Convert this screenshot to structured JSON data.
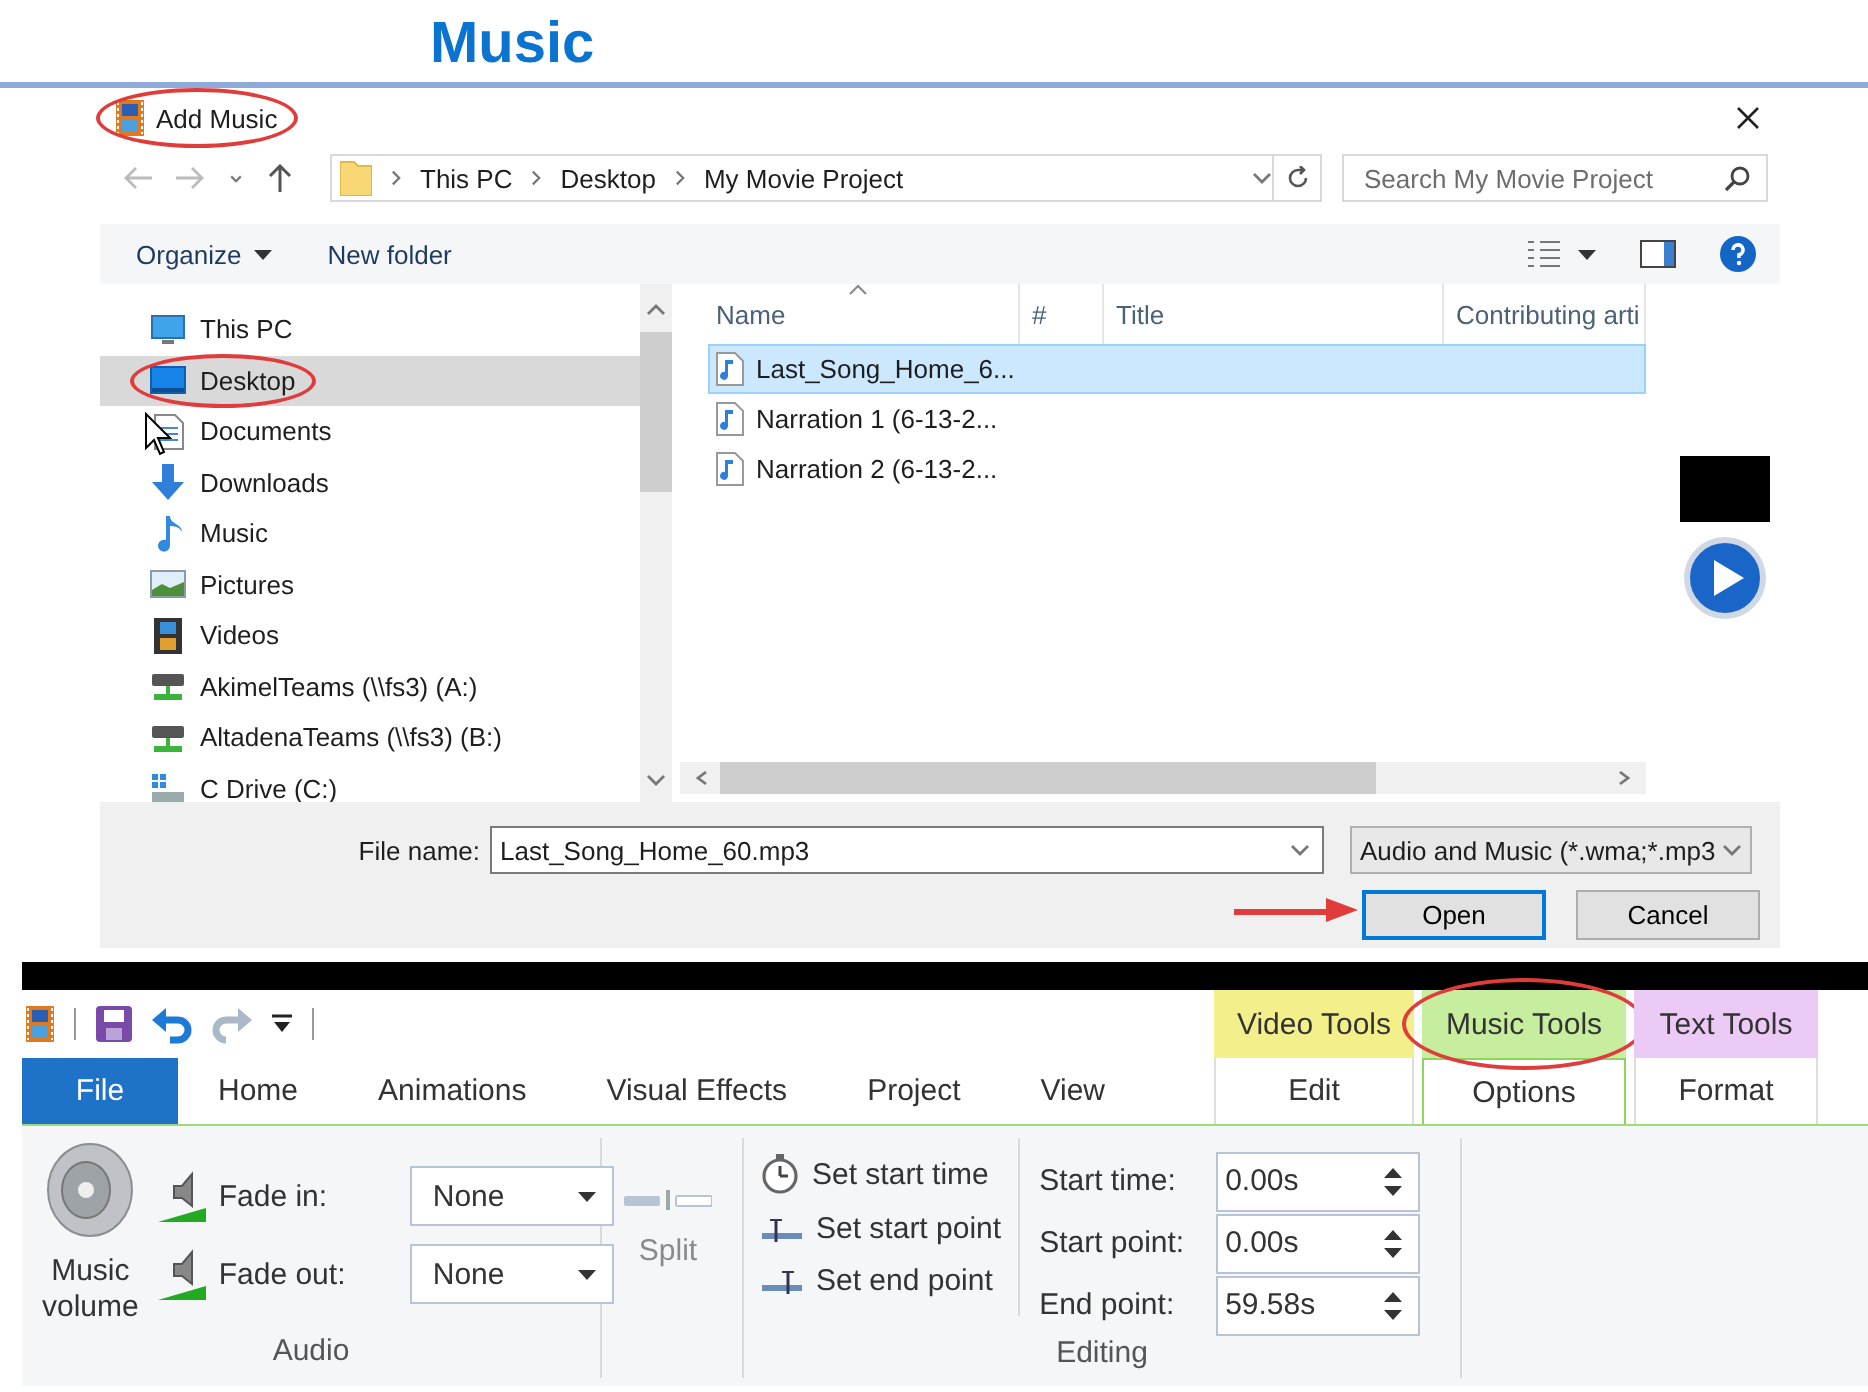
{
  "heading": "Music",
  "dialog": {
    "title": "Add Music",
    "title_circled": true,
    "breadcrumb": [
      "This PC",
      "Desktop",
      "My Movie Project"
    ],
    "search": {
      "placeholder": "Search My Movie Project"
    },
    "toolbar": [
      {
        "label": "Organize",
        "kind": "menu"
      },
      {
        "label": "New folder",
        "kind": "command"
      }
    ],
    "nav_items": [
      {
        "label": "This PC",
        "kind": "pc",
        "selected": false,
        "circled": false
      },
      {
        "label": "Desktop",
        "kind": "desktop",
        "selected": true,
        "circled": true
      },
      {
        "label": "Documents",
        "kind": "documents",
        "selected": false,
        "circled": false
      },
      {
        "label": "Downloads",
        "kind": "downloads",
        "selected": false,
        "circled": false
      },
      {
        "label": "Music",
        "kind": "music",
        "selected": false,
        "circled": false
      },
      {
        "label": "Pictures",
        "kind": "pictures",
        "selected": false,
        "circled": false
      },
      {
        "label": "Videos",
        "kind": "videos",
        "selected": false,
        "circled": false
      },
      {
        "label": "AkimelTeams (\\\\fs3) (A:)",
        "kind": "network",
        "selected": false,
        "circled": false
      },
      {
        "label": "AltadenaTeams (\\\\fs3) (B:)",
        "kind": "network",
        "selected": false,
        "circled": false
      },
      {
        "label": "C Drive (C:)",
        "kind": "drive",
        "selected": false,
        "circled": false
      }
    ],
    "columns": [
      "Name",
      "#",
      "Title",
      "Contributing arti"
    ],
    "files": [
      {
        "name": "Last_Song_Home_6...",
        "selected": true
      },
      {
        "name": "Narration 1 (6-13-2...",
        "selected": false
      },
      {
        "name": "Narration 2 (6-13-2...",
        "selected": false
      }
    ],
    "file_name": {
      "label": "File name:",
      "value": "Last_Song_Home_60.mp3"
    },
    "file_type": "Audio and Music (*.wma;*.mp3",
    "buttons": [
      {
        "label": "Open",
        "default": true,
        "pointed": true
      },
      {
        "label": "Cancel",
        "default": false,
        "pointed": false
      }
    ]
  },
  "ribbon": {
    "tabs": [
      {
        "label": "File",
        "kind": "file",
        "selected": false
      },
      {
        "label": "Home",
        "kind": "main",
        "selected": false
      },
      {
        "label": "Animations",
        "kind": "main",
        "selected": false
      },
      {
        "label": "Visual Effects",
        "kind": "main",
        "selected": false
      },
      {
        "label": "Project",
        "kind": "main",
        "selected": false
      },
      {
        "label": "View",
        "kind": "main",
        "selected": false
      }
    ],
    "contextual": [
      {
        "label": "Video Tools",
        "color": "#f3f08c",
        "circled": false,
        "tab": {
          "label": "Edit",
          "selected": false
        }
      },
      {
        "label": "Music Tools",
        "color": "#c6ee9e",
        "circled": true,
        "tab": {
          "label": "Options",
          "selected": true
        }
      },
      {
        "label": "Text Tools",
        "color": "#ebcaf6",
        "circled": false,
        "tab": {
          "label": "Format",
          "selected": false
        }
      }
    ],
    "audio": {
      "volume_label": "Music volume",
      "fades": [
        {
          "label": "Fade in:",
          "value": "None"
        },
        {
          "label": "Fade out:",
          "value": "None"
        }
      ],
      "group_label": "Audio"
    },
    "split": {
      "label": "Split",
      "disabled": true
    },
    "editing": {
      "commands": [
        {
          "label": "Set start time",
          "kind": "timer"
        },
        {
          "label": "Set start point",
          "kind": "start"
        },
        {
          "label": "Set end point",
          "kind": "end"
        }
      ],
      "fields": [
        {
          "label": "Start time:",
          "value": "0.00s"
        },
        {
          "label": "Start point:",
          "value": "0.00s"
        },
        {
          "label": "End point:",
          "value": "59.58s"
        }
      ],
      "group_label": "Editing"
    }
  }
}
